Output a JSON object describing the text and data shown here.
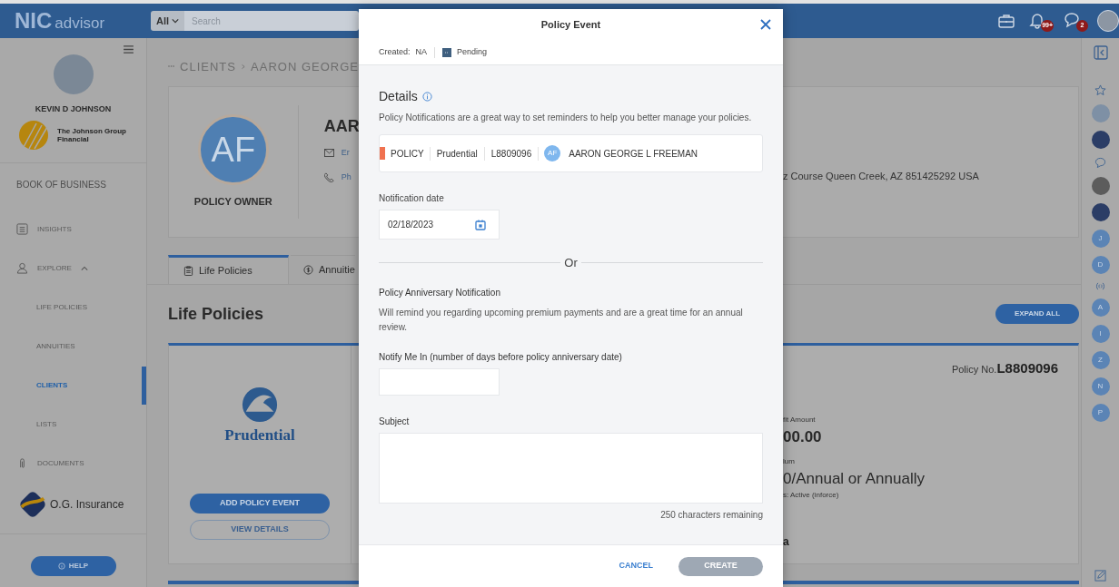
{
  "header": {
    "logo_main": "NIC",
    "logo_sub": "advisor",
    "search_scope": "All",
    "search_placeholder": "Search",
    "notifications_badge": "99+",
    "messages_badge": "2"
  },
  "sidebar": {
    "user_name": "KEVIN D JOHNSON",
    "company": "The Johnson Group Financial",
    "section": "BOOK OF BUSINESS",
    "items": [
      {
        "kind": "link",
        "label": "INSIGHTS"
      },
      {
        "kind": "group",
        "label": "EXPLORE",
        "expanded": true,
        "children": [
          {
            "label": "LIFE POLICIES",
            "selected": false
          },
          {
            "label": "ANNUITIES",
            "selected": false
          },
          {
            "label": "CLIENTS",
            "selected": true
          },
          {
            "label": "LISTS",
            "selected": false
          }
        ]
      },
      {
        "kind": "link",
        "label": "DOCUMENTS"
      }
    ],
    "agency": "O.G. Insurance",
    "help": "HELP"
  },
  "breadcrumb": [
    "CLIENTS",
    "AARON GEORGE"
  ],
  "client": {
    "initials": "AF",
    "role": "POLICY OWNER",
    "name": "AAR",
    "email_label": "Er",
    "phone_label": "Ph",
    "address": "z Course Queen Creek, AZ 851425292 USA"
  },
  "tabs": [
    {
      "label": "Life Policies",
      "selected": true
    },
    {
      "label": "Annuitie",
      "selected": false
    }
  ],
  "section_title": "Life Policies",
  "expand_all": "EXPAND ALL",
  "policy_card": {
    "carrier": "Prudential",
    "add_event": "ADD POLICY EVENT",
    "view_details": "VIEW DETAILS",
    "policy_no_label": "Policy No.",
    "policy_no": "L8809096",
    "benefit_label": "fit Amount",
    "benefit_value": "00.00",
    "premium_label": "lum",
    "premium_value": "0/Annual or Annually",
    "status": "s: Active (inforce)",
    "column_3": "a"
  },
  "right_rail": {
    "avatars": [
      "J",
      "D",
      "A",
      "I",
      "Z",
      "N",
      "P"
    ]
  },
  "modal": {
    "title": "Policy Event",
    "created_label": "Created:",
    "created_value": "NA",
    "status": "Pending",
    "details_title": "Details",
    "details_text": "Policy Notifications are a great way to set reminders to help you better manage your policies.",
    "policy": {
      "tag": "POLICY",
      "carrier": "Prudential",
      "number": "L8809096",
      "initials": "AF",
      "owner": "AARON GEORGE L FREEMAN"
    },
    "date_label": "Notification date",
    "date_value": "02/18/2023",
    "divider_text": "Or",
    "anniversary_title": "Policy Anniversary Notification",
    "anniversary_text": "Will remind you regarding upcoming premium payments and are a great time for an annual review.",
    "days_label": "Notify Me In (number of days before policy anniversary date)",
    "subject_label": "Subject",
    "remaining": "250 characters remaining",
    "cancel": "CANCEL",
    "create": {
      "label": "CREATE",
      "disabled": true
    }
  }
}
